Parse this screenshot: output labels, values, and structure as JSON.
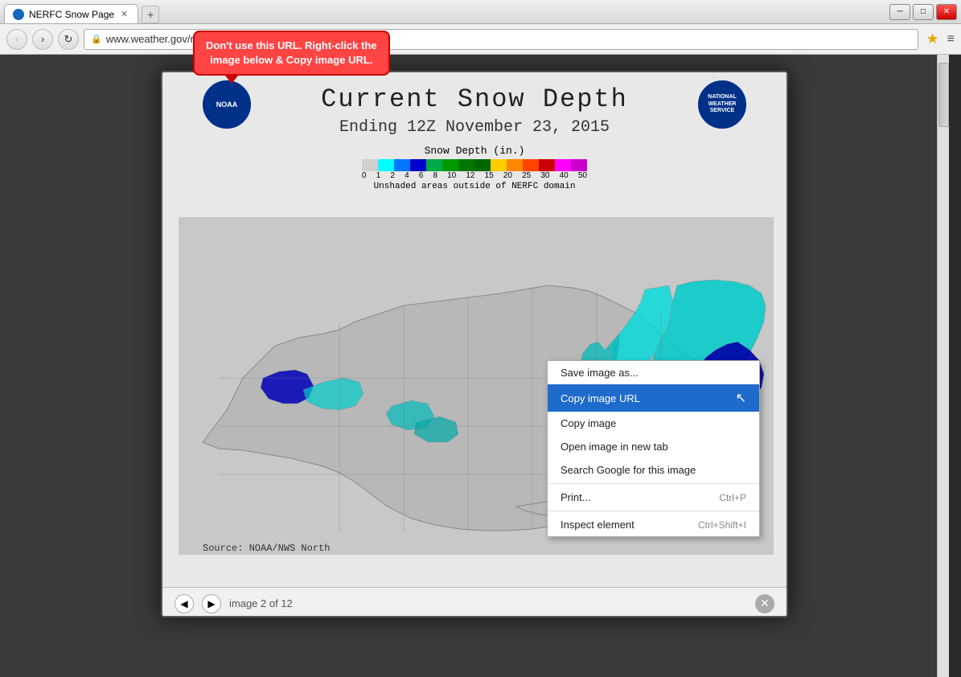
{
  "browser": {
    "title": "NERFC Snow Page",
    "url": "www.weather.gov/nerfc/snow",
    "tab_label": "NERFC Snow Page",
    "nav": {
      "back_label": "‹",
      "forward_label": "›",
      "refresh_label": "↻"
    },
    "controls": {
      "minimize": "─",
      "maximize": "□",
      "close": "✕"
    }
  },
  "callout": {
    "line1": "Don't use this URL. Right-click the",
    "line2": "image below & Copy image URL."
  },
  "map": {
    "title": "Current Snow Depth",
    "subtitle": "Ending 12Z November 23, 2015",
    "noaa_label": "NOAA",
    "nws_label": "NATIONAL WEATHER SERVICE",
    "legend_title": "Snow Depth (in.)",
    "legend_note": "Unshaded areas outside of NERFC domain",
    "legend_labels": [
      "0",
      "1",
      "2",
      "4",
      "6",
      "8",
      "10",
      "12",
      "15",
      "20",
      "25",
      "30",
      "40",
      "50"
    ],
    "legend_colors": [
      "#d0d0d0",
      "#00ffff",
      "#0000ff",
      "#0055ff",
      "#00aaff",
      "#00cc44",
      "#00aa00",
      "#007700",
      "#ffaa00",
      "#ff6600",
      "#ff0000",
      "#cc0000",
      "#ff00ff",
      "#cc00cc"
    ],
    "source_text": "Source: NOAA/NWS North",
    "image_counter": "image 2 of 12"
  },
  "context_menu": {
    "items": [
      {
        "label": "Save image as...",
        "shortcut": "",
        "highlighted": false,
        "id": "save-image"
      },
      {
        "label": "Copy image URL",
        "shortcut": "",
        "highlighted": true,
        "id": "copy-image-url"
      },
      {
        "label": "Copy image",
        "shortcut": "",
        "highlighted": false,
        "id": "copy-image"
      },
      {
        "label": "Open image in new tab",
        "shortcut": "",
        "highlighted": false,
        "id": "open-image-new-tab"
      },
      {
        "label": "Search Google for this image",
        "shortcut": "",
        "highlighted": false,
        "id": "search-google"
      },
      {
        "label": "Print...",
        "shortcut": "Ctrl+P",
        "highlighted": false,
        "id": "print"
      },
      {
        "label": "Inspect element",
        "shortcut": "Ctrl+Shift+I",
        "highlighted": false,
        "id": "inspect-element"
      }
    ]
  },
  "lightbox": {
    "close_label": "✕",
    "prev_label": "◀",
    "next_label": "▶"
  }
}
